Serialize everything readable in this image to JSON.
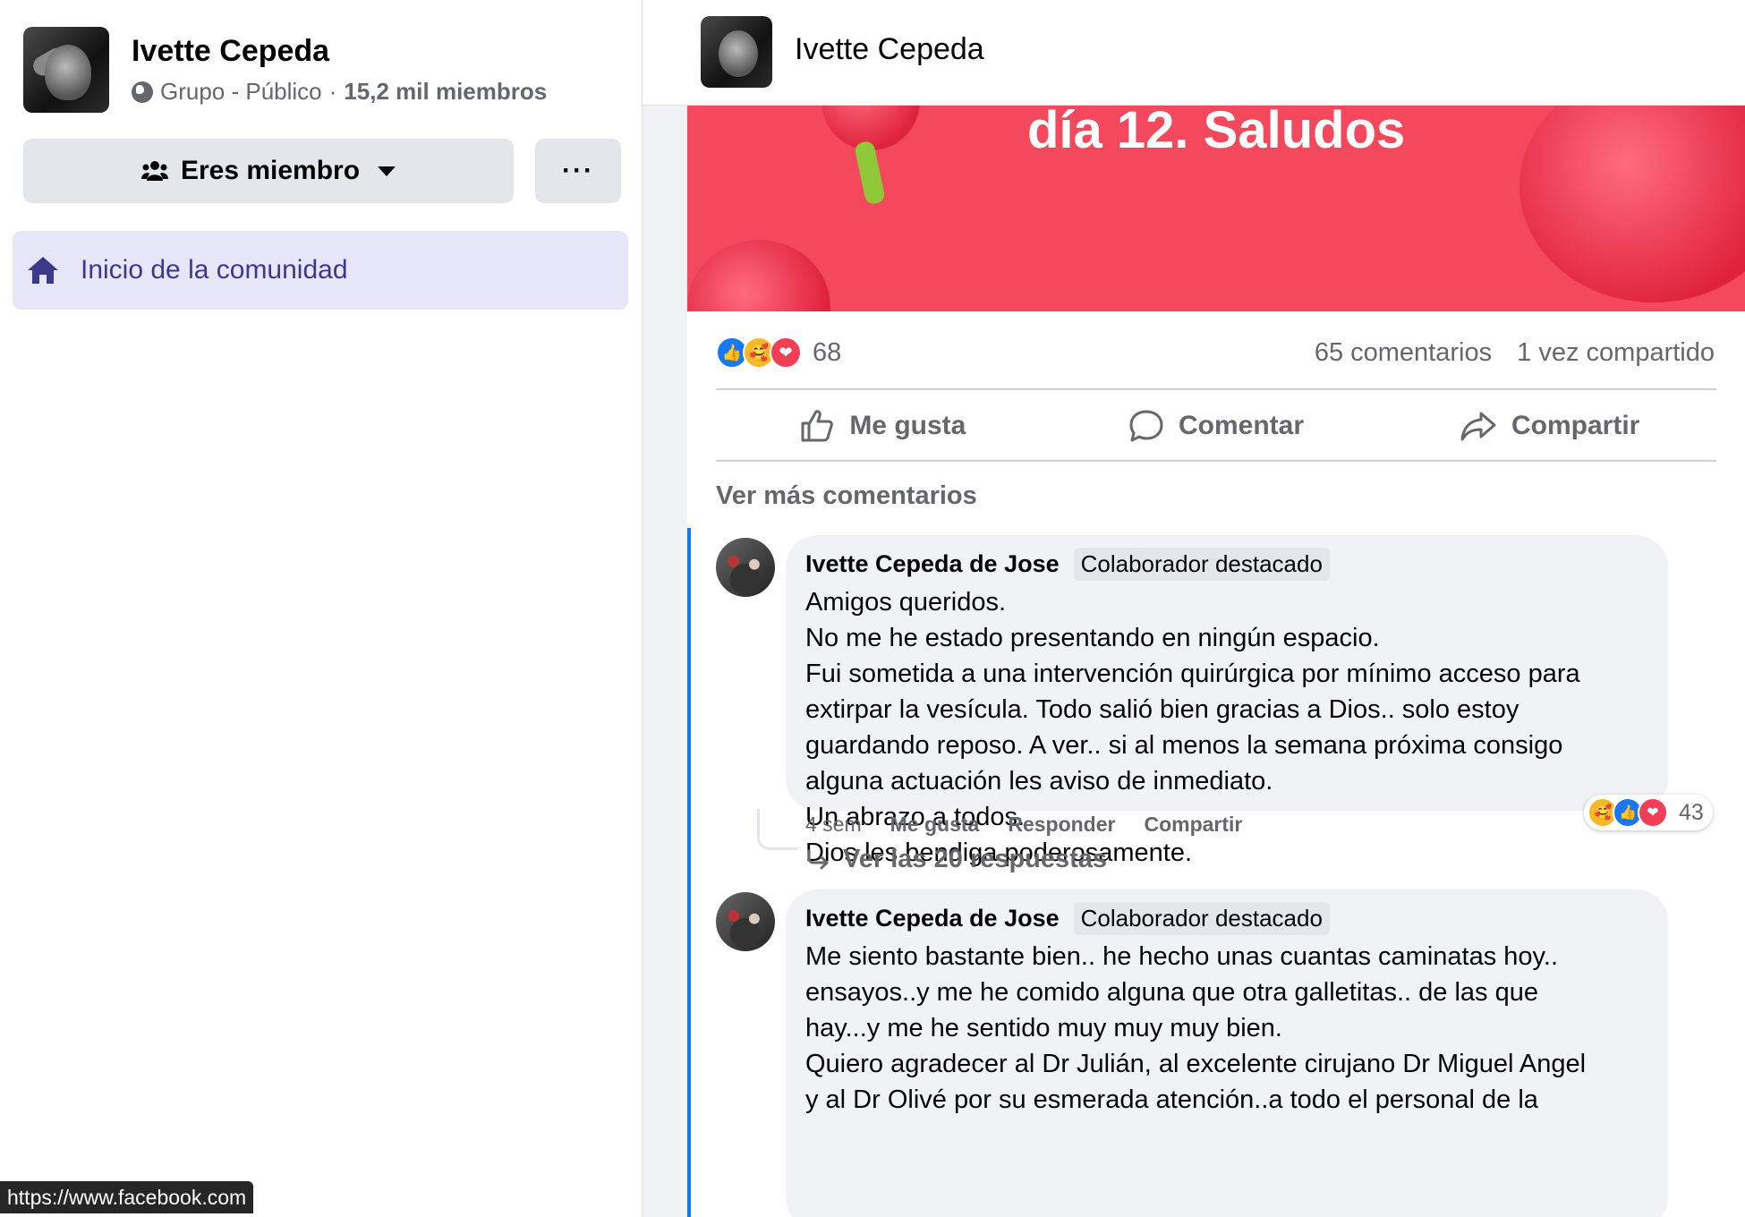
{
  "sidebar": {
    "group_name": "Ivette Cepeda",
    "group_type": "Grupo - Público",
    "separator": "·",
    "members": "15,2 mil miembros",
    "member_button": "Eres miembro",
    "more_button": "···",
    "nav_home": "Inicio de la comunidad"
  },
  "status_url": "https://www.facebook.com",
  "header": {
    "title": "Ivette Cepeda"
  },
  "post": {
    "banner_text": "día 12. Saludos",
    "reaction_count": "68",
    "comments_count": "65 comentarios",
    "shares_count": "1 vez compartido",
    "actions": {
      "like": "Me gusta",
      "comment": "Comentar",
      "share": "Compartir"
    },
    "more_comments": "Ver más comentarios"
  },
  "comments": [
    {
      "author": "Ivette Cepeda de Jose",
      "badge": "Colaborador destacado",
      "lines": [
        "Amigos queridos.",
        "No me he estado presentando en ningún espacio.",
        "Fui sometida a una intervención quirúrgica por mínimo acceso para",
        "extirpar la vesícula. Todo salió bien gracias a Dios.. solo estoy",
        "guardando reposo. A ver.. si al menos la semana próxima consigo",
        "alguna actuación les aviso de inmediato.",
        "Un abrazo a todos.",
        "Dios les bendiga poderosamente."
      ],
      "time": "4 sem",
      "like": "Me gusta",
      "reply": "Responder",
      "share": "Compartir",
      "reactions": "43",
      "replies": "Ver las 20 respuestas"
    },
    {
      "author": "Ivette Cepeda de Jose",
      "badge": "Colaborador destacado",
      "lines": [
        "Me siento bastante bien.. he hecho unas cuantas caminatas hoy..",
        "ensayos..y me he comido alguna que otra galletitas.. de las que",
        "hay...y me he sentido muy muy muy bien.",
        "Quiero agradecer al Dr Julián, al excelente cirujano Dr Miguel Angel",
        "y al Dr Olivé por su esmerada atención..a todo el personal de la"
      ]
    }
  ],
  "colors": {
    "accent": "#1877f2",
    "banner": "#f4485c",
    "nav_active_bg": "#e7e6f9",
    "nav_active_text": "#3b3a8a"
  },
  "icons": {
    "home": "home-icon",
    "members": "members-icon",
    "globe": "globe-icon",
    "like": "thumbs-up-icon",
    "comment": "comment-icon",
    "share": "share-arrow-icon",
    "reply_arrow": "reply-arrow-icon"
  }
}
